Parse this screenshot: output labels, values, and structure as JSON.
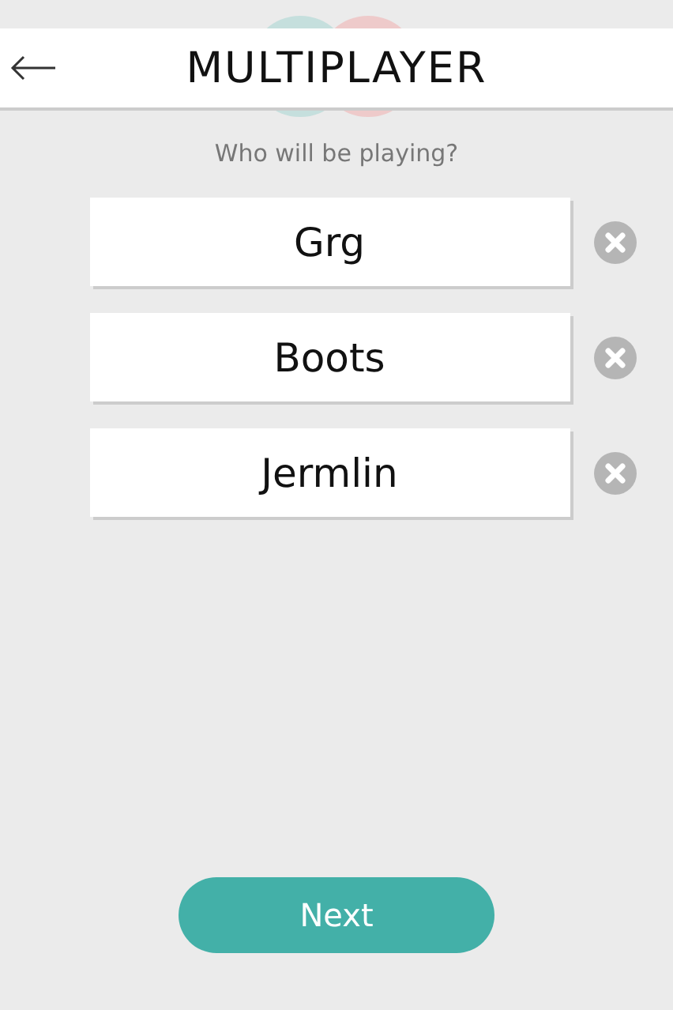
{
  "header": {
    "title": "MULTIPLAYER"
  },
  "prompt": "Who will be playing?",
  "players": [
    {
      "name": "Grg"
    },
    {
      "name": "Boots"
    },
    {
      "name": "Jermlin"
    }
  ],
  "next_button": "Next"
}
